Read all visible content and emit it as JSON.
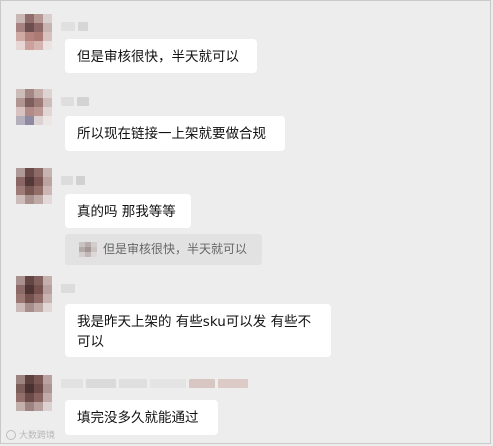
{
  "chat": {
    "messages": [
      {
        "text": "但是审核很快，半天就可以"
      },
      {
        "text": "所以现在链接一上架就要做合规"
      },
      {
        "text": "真的吗 那我等等",
        "quote": "但是审核很快，半天就可以"
      },
      {
        "text": "我是昨天上架的 有些sku可以发 有些不可以"
      },
      {
        "text": "填完没多久就能通过"
      }
    ]
  },
  "watermark": {
    "text": "大数跨境"
  },
  "colors": {
    "background": "#ededed",
    "bubble": "#ffffff",
    "quote_bg": "#e2e2e2"
  }
}
